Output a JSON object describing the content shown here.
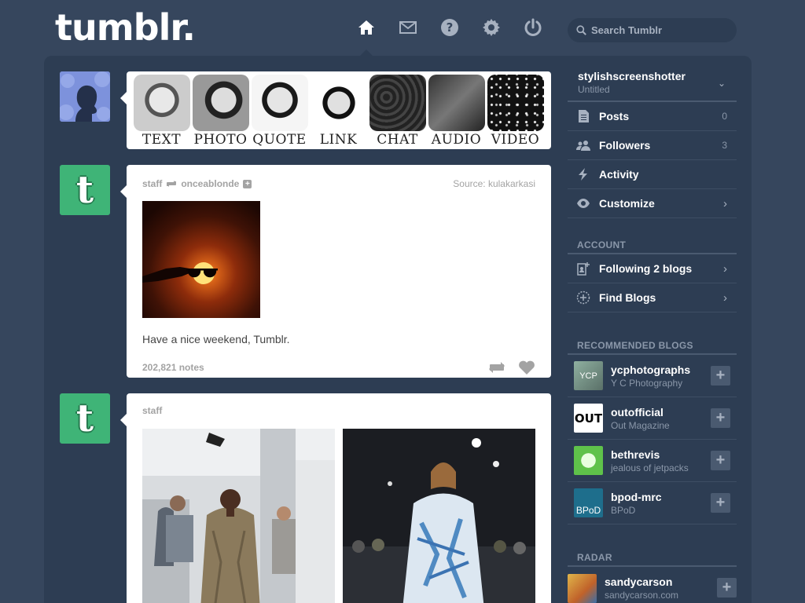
{
  "header": {
    "logo": "tumblr.",
    "nav": [
      {
        "icon": "home-icon"
      },
      {
        "icon": "mail-icon"
      },
      {
        "icon": "help-icon"
      },
      {
        "icon": "settings-icon"
      },
      {
        "icon": "power-icon"
      }
    ],
    "search_placeholder": "Search Tumblr"
  },
  "post_types": [
    "TEXT",
    "PHOTO",
    "QUOTE",
    "LINK",
    "CHAT",
    "AUDIO",
    "VIDEO"
  ],
  "posts": [
    {
      "author": "staff",
      "reblogged_from": "onceablonde",
      "source": "Source: kulakarkasi",
      "caption": "Have a nice weekend, Tumblr.",
      "notes": "202,821 notes"
    },
    {
      "author": "staff"
    }
  ],
  "sidebar": {
    "blog_name": "stylishscreenshotter",
    "blog_title": "Untitled",
    "items": [
      {
        "label": "Posts",
        "count": "0"
      },
      {
        "label": "Followers",
        "count": "3"
      },
      {
        "label": "Activity"
      },
      {
        "label": "Customize"
      }
    ],
    "account_heading": "ACCOUNT",
    "account_items": [
      {
        "label": "Following 2 blogs"
      },
      {
        "label": "Find Blogs"
      }
    ],
    "recommended_heading": "RECOMMENDED BLOGS",
    "recommended": [
      {
        "name": "ycphotographs",
        "title": "Y C Photography",
        "badge": "YCP",
        "color": "#6f8a7e"
      },
      {
        "name": "outofficial",
        "title": "Out Magazine",
        "badge": "OUT",
        "color": "#ffffff"
      },
      {
        "name": "bethrevis",
        "title": "jealous of jetpacks",
        "badge": "",
        "color": "#5fc24a"
      },
      {
        "name": "bpod-mrc",
        "title": "BPoD",
        "badge": "BPoD",
        "color": "#1e6e8c"
      }
    ],
    "radar_heading": "RADAR",
    "radar": {
      "name": "sandycarson",
      "url": "sandycarson.com"
    }
  }
}
